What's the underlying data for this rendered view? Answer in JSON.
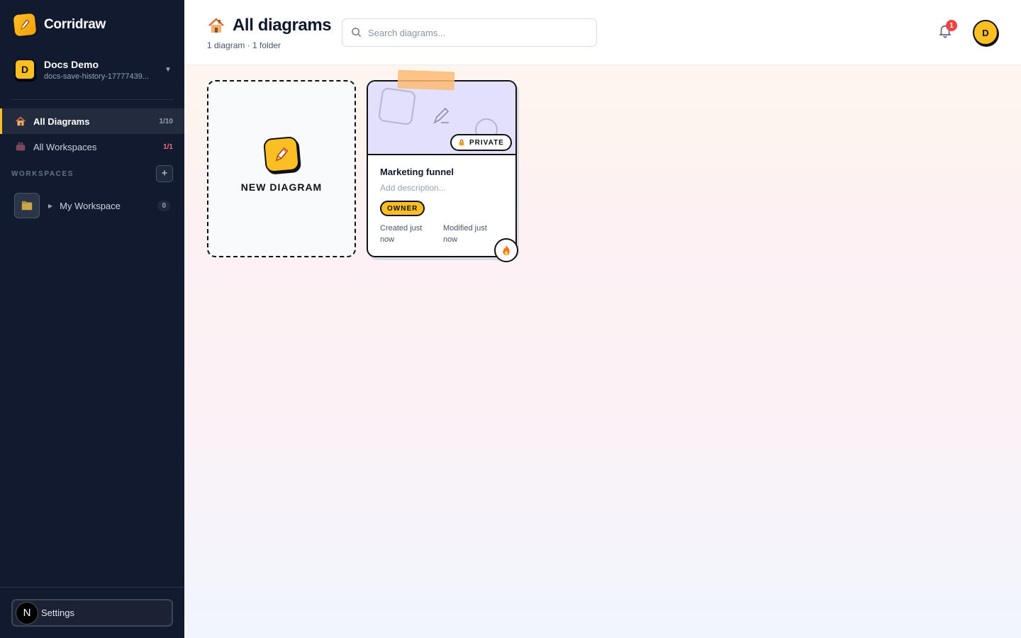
{
  "app": {
    "name": "Corridraw"
  },
  "account": {
    "initial": "D",
    "name": "Docs Demo",
    "slug": "docs-save-history-17777439..."
  },
  "nav": [
    {
      "label": "All Diagrams",
      "count": "1/10",
      "active": true,
      "icon": "house-icon"
    },
    {
      "label": "All Workspaces",
      "count": "1/1",
      "active": false,
      "icon": "briefcase-icon"
    }
  ],
  "workspaces": {
    "title": "WORKSPACES",
    "add_label": "+",
    "items": [
      {
        "label": "My Workspace",
        "count": "0",
        "icon": "folder-icon"
      }
    ]
  },
  "settings": {
    "initial": "N",
    "label": "Settings"
  },
  "header": {
    "title": "All diagrams",
    "subtitle": "1 diagram · 1 folder",
    "search_placeholder": "Search diagrams...",
    "notification_count": "1",
    "user_initial": "D"
  },
  "new_diagram": {
    "label": "NEW DIAGRAM"
  },
  "diagrams": [
    {
      "title": "Marketing funnel",
      "description_placeholder": "Add description...",
      "visibility": "PRIVATE",
      "role": "OWNER",
      "created": "Created just now",
      "modified": "Modified just now",
      "status_icon": "fire-icon"
    }
  ],
  "colors": {
    "sidebar_bg": "#111a2e",
    "accent": "#fbbf24",
    "danger": "#ef4444",
    "thumb_bg": "#e2e0fb"
  }
}
